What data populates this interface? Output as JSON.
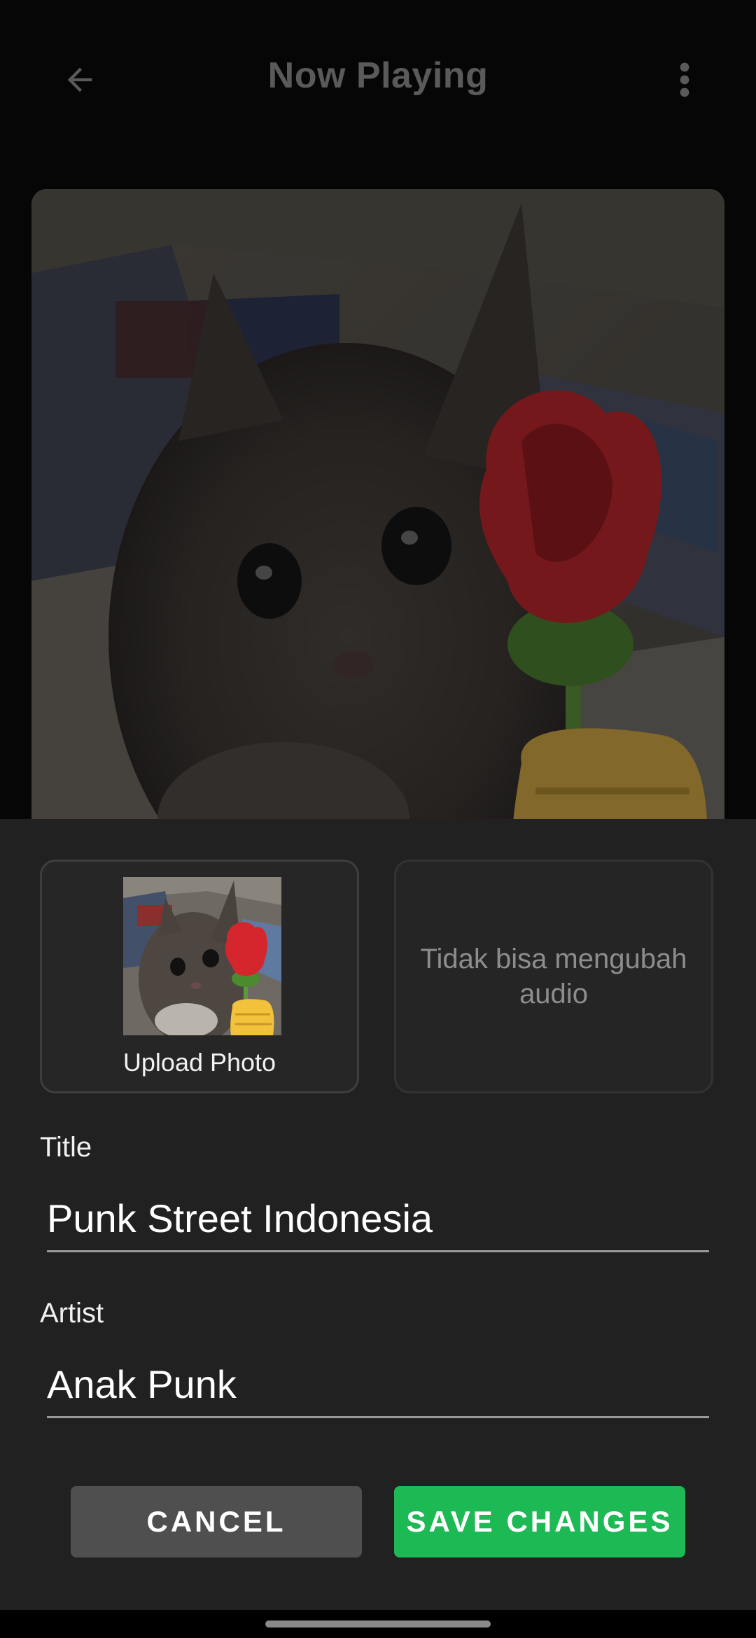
{
  "app_bar": {
    "title": "Now Playing",
    "back_icon": "arrow-left-icon",
    "more_icon": "more-vert-icon"
  },
  "artwork": {
    "description_icon": "album-art-image"
  },
  "sheet": {
    "upload_photo_label": "Upload Photo",
    "audio_card_label": "Tidak bisa mengubah audio",
    "title_label": "Title",
    "title_value": "Punk Street Indonesia",
    "artist_label": "Artist",
    "artist_value": "Anak Punk",
    "cancel_label": "CANCEL",
    "save_label": "SAVE CHANGES"
  },
  "colors": {
    "accent": "#1db954",
    "sheet_bg": "#212121",
    "cancel_bg": "#4f4f4f"
  }
}
